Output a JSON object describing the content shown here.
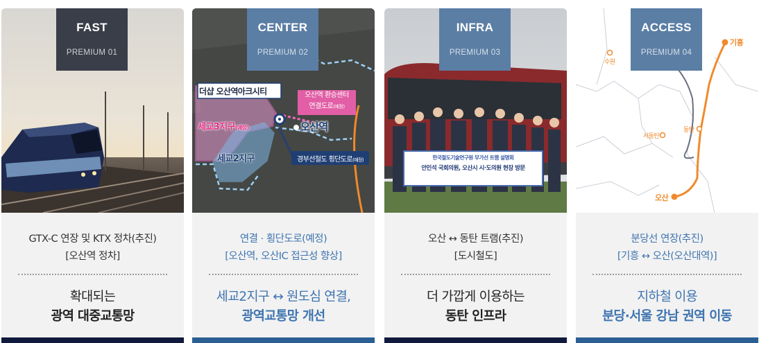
{
  "cards": [
    {
      "tag": "FAST",
      "premium": "PREMIUM 01",
      "line1": "GTX-C 연장 및 KTX 정차(추진)",
      "line2": "[오산역 정차]",
      "big1": "확대되는",
      "big2": "광역 대중교통망"
    },
    {
      "tag": "CENTER",
      "premium": "PREMIUM 02",
      "line1": "연결 · 횡단도로(예정)",
      "line2": "[오산역, 오산IC 접근성 향상]",
      "big1": "세교2지구 ↔ 원도심 연결,",
      "big2": "광역교통망 개선",
      "map": {
        "complex": "더샵 오산역아크시티",
        "transfer_center_1": "오산역 환승센터",
        "transfer_center_2": "연결도로",
        "transfer_center_note": "(예정)",
        "sego3": "세교3지구",
        "sego3_note": "(예정)",
        "sego2": "세교2지구",
        "station": "오산역",
        "crossing": "경부선철도 횡단도로",
        "crossing_note": "(예정)"
      }
    },
    {
      "tag": "INFRA",
      "premium": "PREMIUM 03",
      "line1": "오산 ↔ 동탄 트램(추진)",
      "line2": "[도시철도]",
      "big1": "더 가깝게 이용하는",
      "big2": "동탄 인프라",
      "banner": {
        "l1": "한국철도기술연구원 무가선 트램 설명회",
        "l2": "안민석 국회의원, 오산시 시·도의원 현장 방문"
      }
    },
    {
      "tag": "ACCESS",
      "premium": "PREMIUM 04",
      "line1": "분당선 연장(추진)",
      "line2": "[기흥 ↔ 오산(오산대역)]",
      "big1": "지하철 이용",
      "big2": "분당·서울 강남 권역 이동",
      "map": {
        "giheung": "기흥",
        "suwon": "수원",
        "dongtan": "동탄",
        "seodongtan": "서동탄",
        "osan": "오산"
      }
    }
  ],
  "colors": {
    "dark_tag": "#3a3e49",
    "blue_tag": "#5b7ea5",
    "dark_bar": "#0f1a3c",
    "blue_bar": "#2a5f93",
    "blue_text": "#3f74b0",
    "route_orange": "#f08a2c"
  }
}
